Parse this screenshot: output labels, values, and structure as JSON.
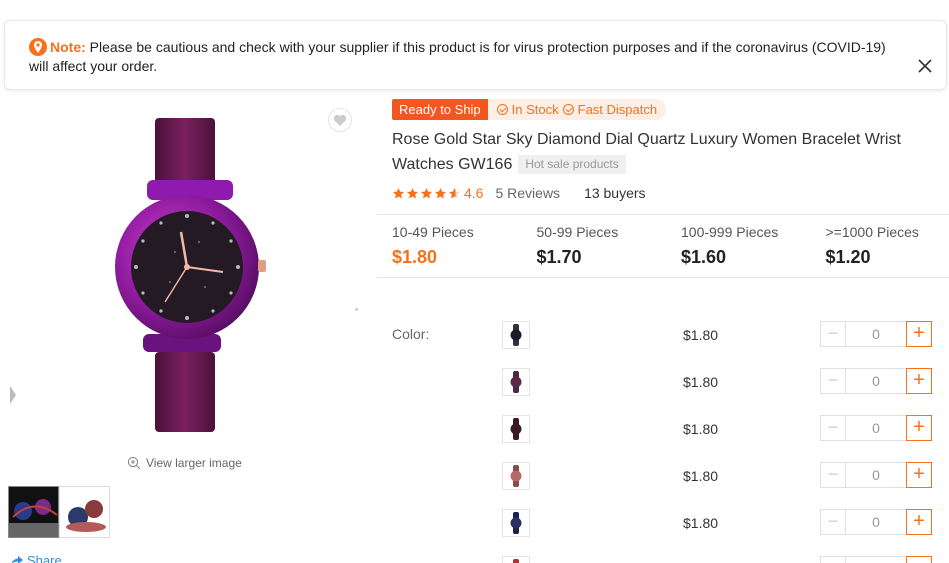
{
  "notice": {
    "label": "Note:",
    "message": "Please be cautious and check with your supplier if this product is for virus protection purposes and if the coronavirus (COVID-19) will affect your order."
  },
  "gallery": {
    "view_larger": "View larger image",
    "share": "Share"
  },
  "product": {
    "badge_ready": "Ready to Ship",
    "badge_in_stock": "In Stock",
    "badge_dispatch": "Fast Dispatch",
    "title": "Rose Gold Star Sky Diamond Dial Quartz Luxury Women Bracelet Wrist Watches GW166",
    "hot_tag": "Hot sale products",
    "rating": "4.6",
    "rating_value": 4.6,
    "reviews": "5 Reviews",
    "buyers": "13 buyers"
  },
  "tiers": [
    {
      "range": "10-49 Pieces",
      "price": "$1.80"
    },
    {
      "range": "50-99 Pieces",
      "price": "$1.70"
    },
    {
      "range": "100-999 Pieces",
      "price": "$1.60"
    },
    {
      "range": ">=1000 Pieces",
      "price": "$1.20"
    }
  ],
  "variants": {
    "label": "Color:",
    "items": [
      {
        "price": "$1.80",
        "qty": "0",
        "dial_color": "#1b1b2a"
      },
      {
        "price": "$1.80",
        "qty": "0",
        "dial_color": "#5a2a4a"
      },
      {
        "price": "$1.80",
        "qty": "0",
        "dial_color": "#3a1a28"
      },
      {
        "price": "$1.80",
        "qty": "0",
        "dial_color": "#b46a6a"
      },
      {
        "price": "$1.80",
        "qty": "0",
        "dial_color": "#2a3060"
      }
    ]
  },
  "colors": {
    "accent": "#f7711a",
    "ready_badge": "#f4561f",
    "link": "#2d8ee8"
  }
}
